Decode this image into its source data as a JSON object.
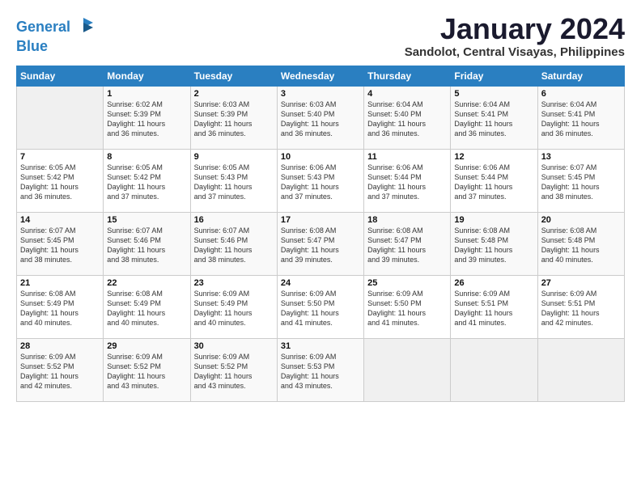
{
  "header": {
    "logo_line1": "General",
    "logo_line2": "Blue",
    "title": "January 2024",
    "subtitle": "Sandolot, Central Visayas, Philippines"
  },
  "weekdays": [
    "Sunday",
    "Monday",
    "Tuesday",
    "Wednesday",
    "Thursday",
    "Friday",
    "Saturday"
  ],
  "weeks": [
    [
      {
        "day": "",
        "info": ""
      },
      {
        "day": "1",
        "info": "Sunrise: 6:02 AM\nSunset: 5:39 PM\nDaylight: 11 hours\nand 36 minutes."
      },
      {
        "day": "2",
        "info": "Sunrise: 6:03 AM\nSunset: 5:39 PM\nDaylight: 11 hours\nand 36 minutes."
      },
      {
        "day": "3",
        "info": "Sunrise: 6:03 AM\nSunset: 5:40 PM\nDaylight: 11 hours\nand 36 minutes."
      },
      {
        "day": "4",
        "info": "Sunrise: 6:04 AM\nSunset: 5:40 PM\nDaylight: 11 hours\nand 36 minutes."
      },
      {
        "day": "5",
        "info": "Sunrise: 6:04 AM\nSunset: 5:41 PM\nDaylight: 11 hours\nand 36 minutes."
      },
      {
        "day": "6",
        "info": "Sunrise: 6:04 AM\nSunset: 5:41 PM\nDaylight: 11 hours\nand 36 minutes."
      }
    ],
    [
      {
        "day": "7",
        "info": "Sunrise: 6:05 AM\nSunset: 5:42 PM\nDaylight: 11 hours\nand 36 minutes."
      },
      {
        "day": "8",
        "info": "Sunrise: 6:05 AM\nSunset: 5:42 PM\nDaylight: 11 hours\nand 37 minutes."
      },
      {
        "day": "9",
        "info": "Sunrise: 6:05 AM\nSunset: 5:43 PM\nDaylight: 11 hours\nand 37 minutes."
      },
      {
        "day": "10",
        "info": "Sunrise: 6:06 AM\nSunset: 5:43 PM\nDaylight: 11 hours\nand 37 minutes."
      },
      {
        "day": "11",
        "info": "Sunrise: 6:06 AM\nSunset: 5:44 PM\nDaylight: 11 hours\nand 37 minutes."
      },
      {
        "day": "12",
        "info": "Sunrise: 6:06 AM\nSunset: 5:44 PM\nDaylight: 11 hours\nand 37 minutes."
      },
      {
        "day": "13",
        "info": "Sunrise: 6:07 AM\nSunset: 5:45 PM\nDaylight: 11 hours\nand 38 minutes."
      }
    ],
    [
      {
        "day": "14",
        "info": "Sunrise: 6:07 AM\nSunset: 5:45 PM\nDaylight: 11 hours\nand 38 minutes."
      },
      {
        "day": "15",
        "info": "Sunrise: 6:07 AM\nSunset: 5:46 PM\nDaylight: 11 hours\nand 38 minutes."
      },
      {
        "day": "16",
        "info": "Sunrise: 6:07 AM\nSunset: 5:46 PM\nDaylight: 11 hours\nand 38 minutes."
      },
      {
        "day": "17",
        "info": "Sunrise: 6:08 AM\nSunset: 5:47 PM\nDaylight: 11 hours\nand 39 minutes."
      },
      {
        "day": "18",
        "info": "Sunrise: 6:08 AM\nSunset: 5:47 PM\nDaylight: 11 hours\nand 39 minutes."
      },
      {
        "day": "19",
        "info": "Sunrise: 6:08 AM\nSunset: 5:48 PM\nDaylight: 11 hours\nand 39 minutes."
      },
      {
        "day": "20",
        "info": "Sunrise: 6:08 AM\nSunset: 5:48 PM\nDaylight: 11 hours\nand 40 minutes."
      }
    ],
    [
      {
        "day": "21",
        "info": "Sunrise: 6:08 AM\nSunset: 5:49 PM\nDaylight: 11 hours\nand 40 minutes."
      },
      {
        "day": "22",
        "info": "Sunrise: 6:08 AM\nSunset: 5:49 PM\nDaylight: 11 hours\nand 40 minutes."
      },
      {
        "day": "23",
        "info": "Sunrise: 6:09 AM\nSunset: 5:49 PM\nDaylight: 11 hours\nand 40 minutes."
      },
      {
        "day": "24",
        "info": "Sunrise: 6:09 AM\nSunset: 5:50 PM\nDaylight: 11 hours\nand 41 minutes."
      },
      {
        "day": "25",
        "info": "Sunrise: 6:09 AM\nSunset: 5:50 PM\nDaylight: 11 hours\nand 41 minutes."
      },
      {
        "day": "26",
        "info": "Sunrise: 6:09 AM\nSunset: 5:51 PM\nDaylight: 11 hours\nand 41 minutes."
      },
      {
        "day": "27",
        "info": "Sunrise: 6:09 AM\nSunset: 5:51 PM\nDaylight: 11 hours\nand 42 minutes."
      }
    ],
    [
      {
        "day": "28",
        "info": "Sunrise: 6:09 AM\nSunset: 5:52 PM\nDaylight: 11 hours\nand 42 minutes."
      },
      {
        "day": "29",
        "info": "Sunrise: 6:09 AM\nSunset: 5:52 PM\nDaylight: 11 hours\nand 43 minutes."
      },
      {
        "day": "30",
        "info": "Sunrise: 6:09 AM\nSunset: 5:52 PM\nDaylight: 11 hours\nand 43 minutes."
      },
      {
        "day": "31",
        "info": "Sunrise: 6:09 AM\nSunset: 5:53 PM\nDaylight: 11 hours\nand 43 minutes."
      },
      {
        "day": "",
        "info": ""
      },
      {
        "day": "",
        "info": ""
      },
      {
        "day": "",
        "info": ""
      }
    ]
  ]
}
